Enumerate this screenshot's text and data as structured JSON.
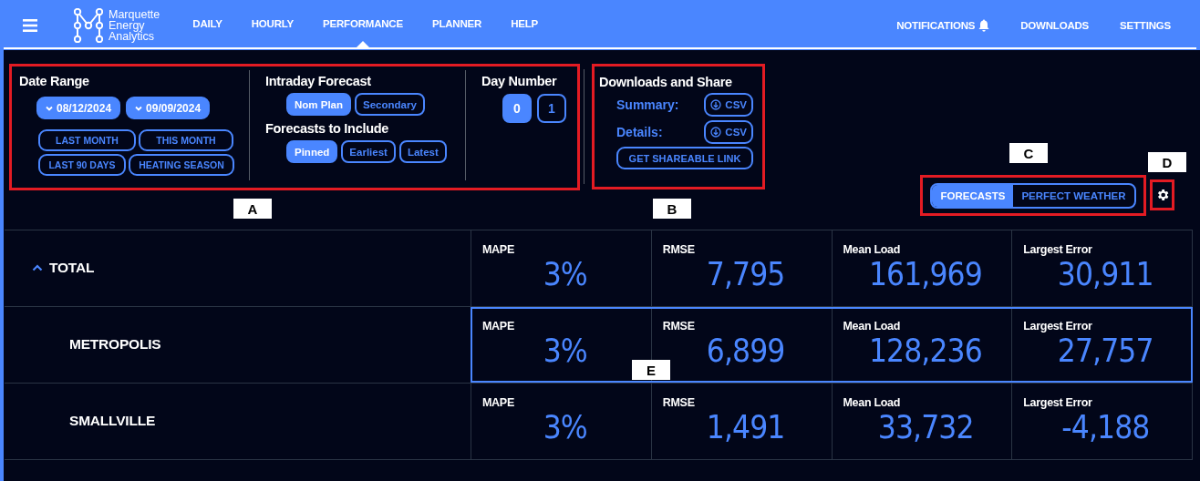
{
  "header": {
    "brand": [
      "Marquette",
      "Energy",
      "Analytics"
    ],
    "nav": [
      {
        "label": "DAILY",
        "selected": false
      },
      {
        "label": "HOURLY",
        "selected": false
      },
      {
        "label": "PERFORMANCE",
        "selected": true
      },
      {
        "label": "PLANNER",
        "selected": false
      },
      {
        "label": "HELP",
        "selected": false
      }
    ],
    "right_nav": [
      {
        "label": "NOTIFICATIONS",
        "kind": "alerts"
      },
      {
        "label": "DOWNLOADS",
        "kind": "link"
      },
      {
        "label": "SETTINGS",
        "kind": "link"
      }
    ]
  },
  "filters": {
    "callout": "A",
    "date_range": {
      "title": "Date Range",
      "dates": [
        "08/12/2024",
        "09/09/2024"
      ],
      "presets": [
        [
          "LAST MONTH",
          "THIS MONTH"
        ],
        [
          "LAST 90 DAYS",
          "HEATING SEASON"
        ]
      ]
    },
    "intraday": {
      "title": "Intraday Forecast",
      "options": [
        {
          "label": "Nom Plan",
          "selected": true
        },
        {
          "label": "Secondary",
          "selected": false
        }
      ]
    },
    "include": {
      "title": "Forecasts to Include",
      "options": [
        {
          "label": "Pinned",
          "selected": true
        },
        {
          "label": "Earliest",
          "selected": false
        },
        {
          "label": "Latest",
          "selected": false
        }
      ]
    },
    "day_number": {
      "title": "Day Number",
      "options": [
        {
          "label": "0",
          "selected": true
        },
        {
          "label": "1",
          "selected": false
        }
      ]
    }
  },
  "downloads": {
    "callout": "B",
    "title": "Downloads and Share",
    "rows": [
      {
        "label": "Summary:",
        "button": "CSV"
      },
      {
        "label": "Details:",
        "button": "CSV"
      }
    ],
    "share_button": "GET SHAREABLE LINK"
  },
  "view_toggle": {
    "callout": "C",
    "options": [
      {
        "label": "FORECASTS",
        "selected": true
      },
      {
        "label": "PERFECT WEATHER",
        "selected": false
      }
    ]
  },
  "settings": {
    "callout": "D"
  },
  "table": {
    "callout": "E",
    "rows": [
      {
        "name": "TOTAL",
        "expanded": true,
        "selected": false,
        "metrics": [
          {
            "label": "MAPE",
            "value": "3%"
          },
          {
            "label": "RMSE",
            "value": "7,795"
          },
          {
            "label": "Mean Load",
            "value": "161,969"
          },
          {
            "label": "Largest Error",
            "value": "30,911"
          }
        ],
        "children": [
          {
            "name": "METROPOLIS",
            "selected": true,
            "metrics": [
              {
                "label": "MAPE",
                "value": "3%"
              },
              {
                "label": "RMSE",
                "value": "6,899"
              },
              {
                "label": "Mean Load",
                "value": "128,236"
              },
              {
                "label": "Largest Error",
                "value": "27,757"
              }
            ]
          },
          {
            "name": "SMALLVILLE",
            "selected": false,
            "metrics": [
              {
                "label": "MAPE",
                "value": "3%"
              },
              {
                "label": "RMSE",
                "value": "1,491"
              },
              {
                "label": "Mean Load",
                "value": "33,732"
              },
              {
                "label": "Largest Error",
                "value": "-4,188"
              }
            ]
          }
        ]
      }
    ]
  }
}
